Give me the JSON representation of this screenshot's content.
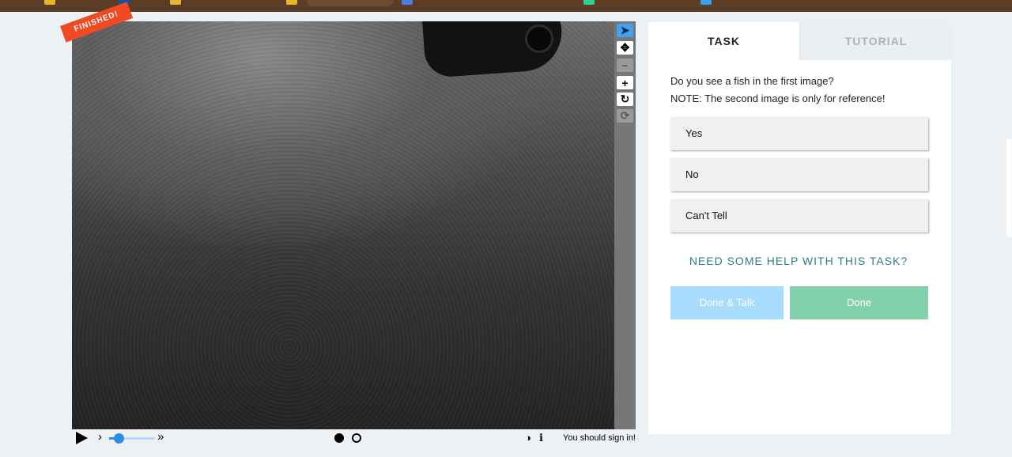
{
  "viewer": {
    "status_ribbon": "FINISHED!",
    "tools": [
      {
        "icon": "pointer-icon",
        "glyph": "➤"
      },
      {
        "icon": "move-icon",
        "glyph": "✥"
      },
      {
        "icon": "zoom-out-icon",
        "glyph": "−"
      },
      {
        "icon": "zoom-in-icon",
        "glyph": "+"
      },
      {
        "icon": "rotate-icon",
        "glyph": "↻"
      },
      {
        "icon": "reset-icon",
        "glyph": "⟳"
      }
    ],
    "controls": {
      "play_icon": "play-icon",
      "step_glyph": "›",
      "fast_glyph": "»",
      "frame_count": 2,
      "current_frame": 1,
      "invert_glyph": "◑",
      "info_glyph": "ℹ",
      "signin_text": "You should sign in!"
    }
  },
  "task": {
    "tabs": [
      {
        "label": "TASK",
        "active": true
      },
      {
        "label": "TUTORIAL",
        "active": false
      }
    ],
    "question_line1": "Do you see a fish in the first image?",
    "question_line2": "NOTE: The second image is only for reference!",
    "answers": [
      "Yes",
      "No",
      "Can't Tell"
    ],
    "help_link": "NEED SOME HELP WITH THIS TASK?",
    "done_talk_label": "Done & Talk",
    "done_label": "Done"
  },
  "colors": {
    "accent_blue": "#43a2f0",
    "ribbon": "#ef4a23",
    "done_green": "#82d1ab",
    "talk_blue": "#a7dcfc",
    "help_teal": "#2f7d8a"
  }
}
